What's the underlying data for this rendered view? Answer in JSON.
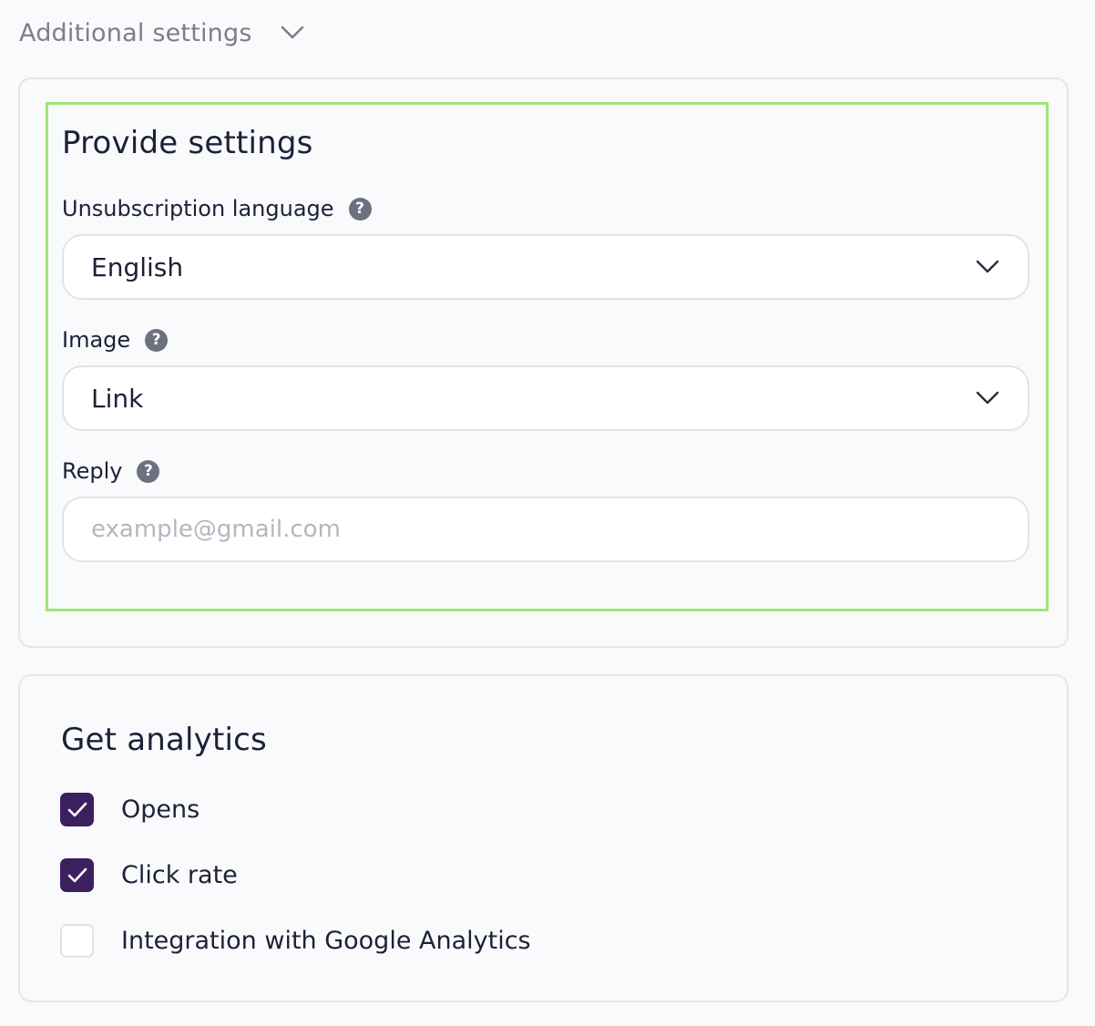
{
  "header": {
    "title": "Additional settings",
    "chevron_icon": "chevron-down-icon"
  },
  "provide_settings": {
    "title": "Provide settings",
    "fields": {
      "unsubscription_language": {
        "label": "Unsubscription language",
        "value": "English",
        "help_icon": "question-icon"
      },
      "image": {
        "label": "Image",
        "value": "Link",
        "help_icon": "question-icon"
      },
      "reply": {
        "label": "Reply",
        "value": "",
        "placeholder": "example@gmail.com",
        "help_icon": "question-icon"
      }
    }
  },
  "analytics": {
    "title": "Get analytics",
    "options": [
      {
        "label": "Opens",
        "checked": true
      },
      {
        "label": "Click rate",
        "checked": true
      },
      {
        "label": "Integration with Google Analytics",
        "checked": false
      }
    ]
  },
  "colors": {
    "highlight_border": "#a0e575",
    "checkbox_checked": "#3b1f5e",
    "help_icon_bg": "#6e7080"
  }
}
